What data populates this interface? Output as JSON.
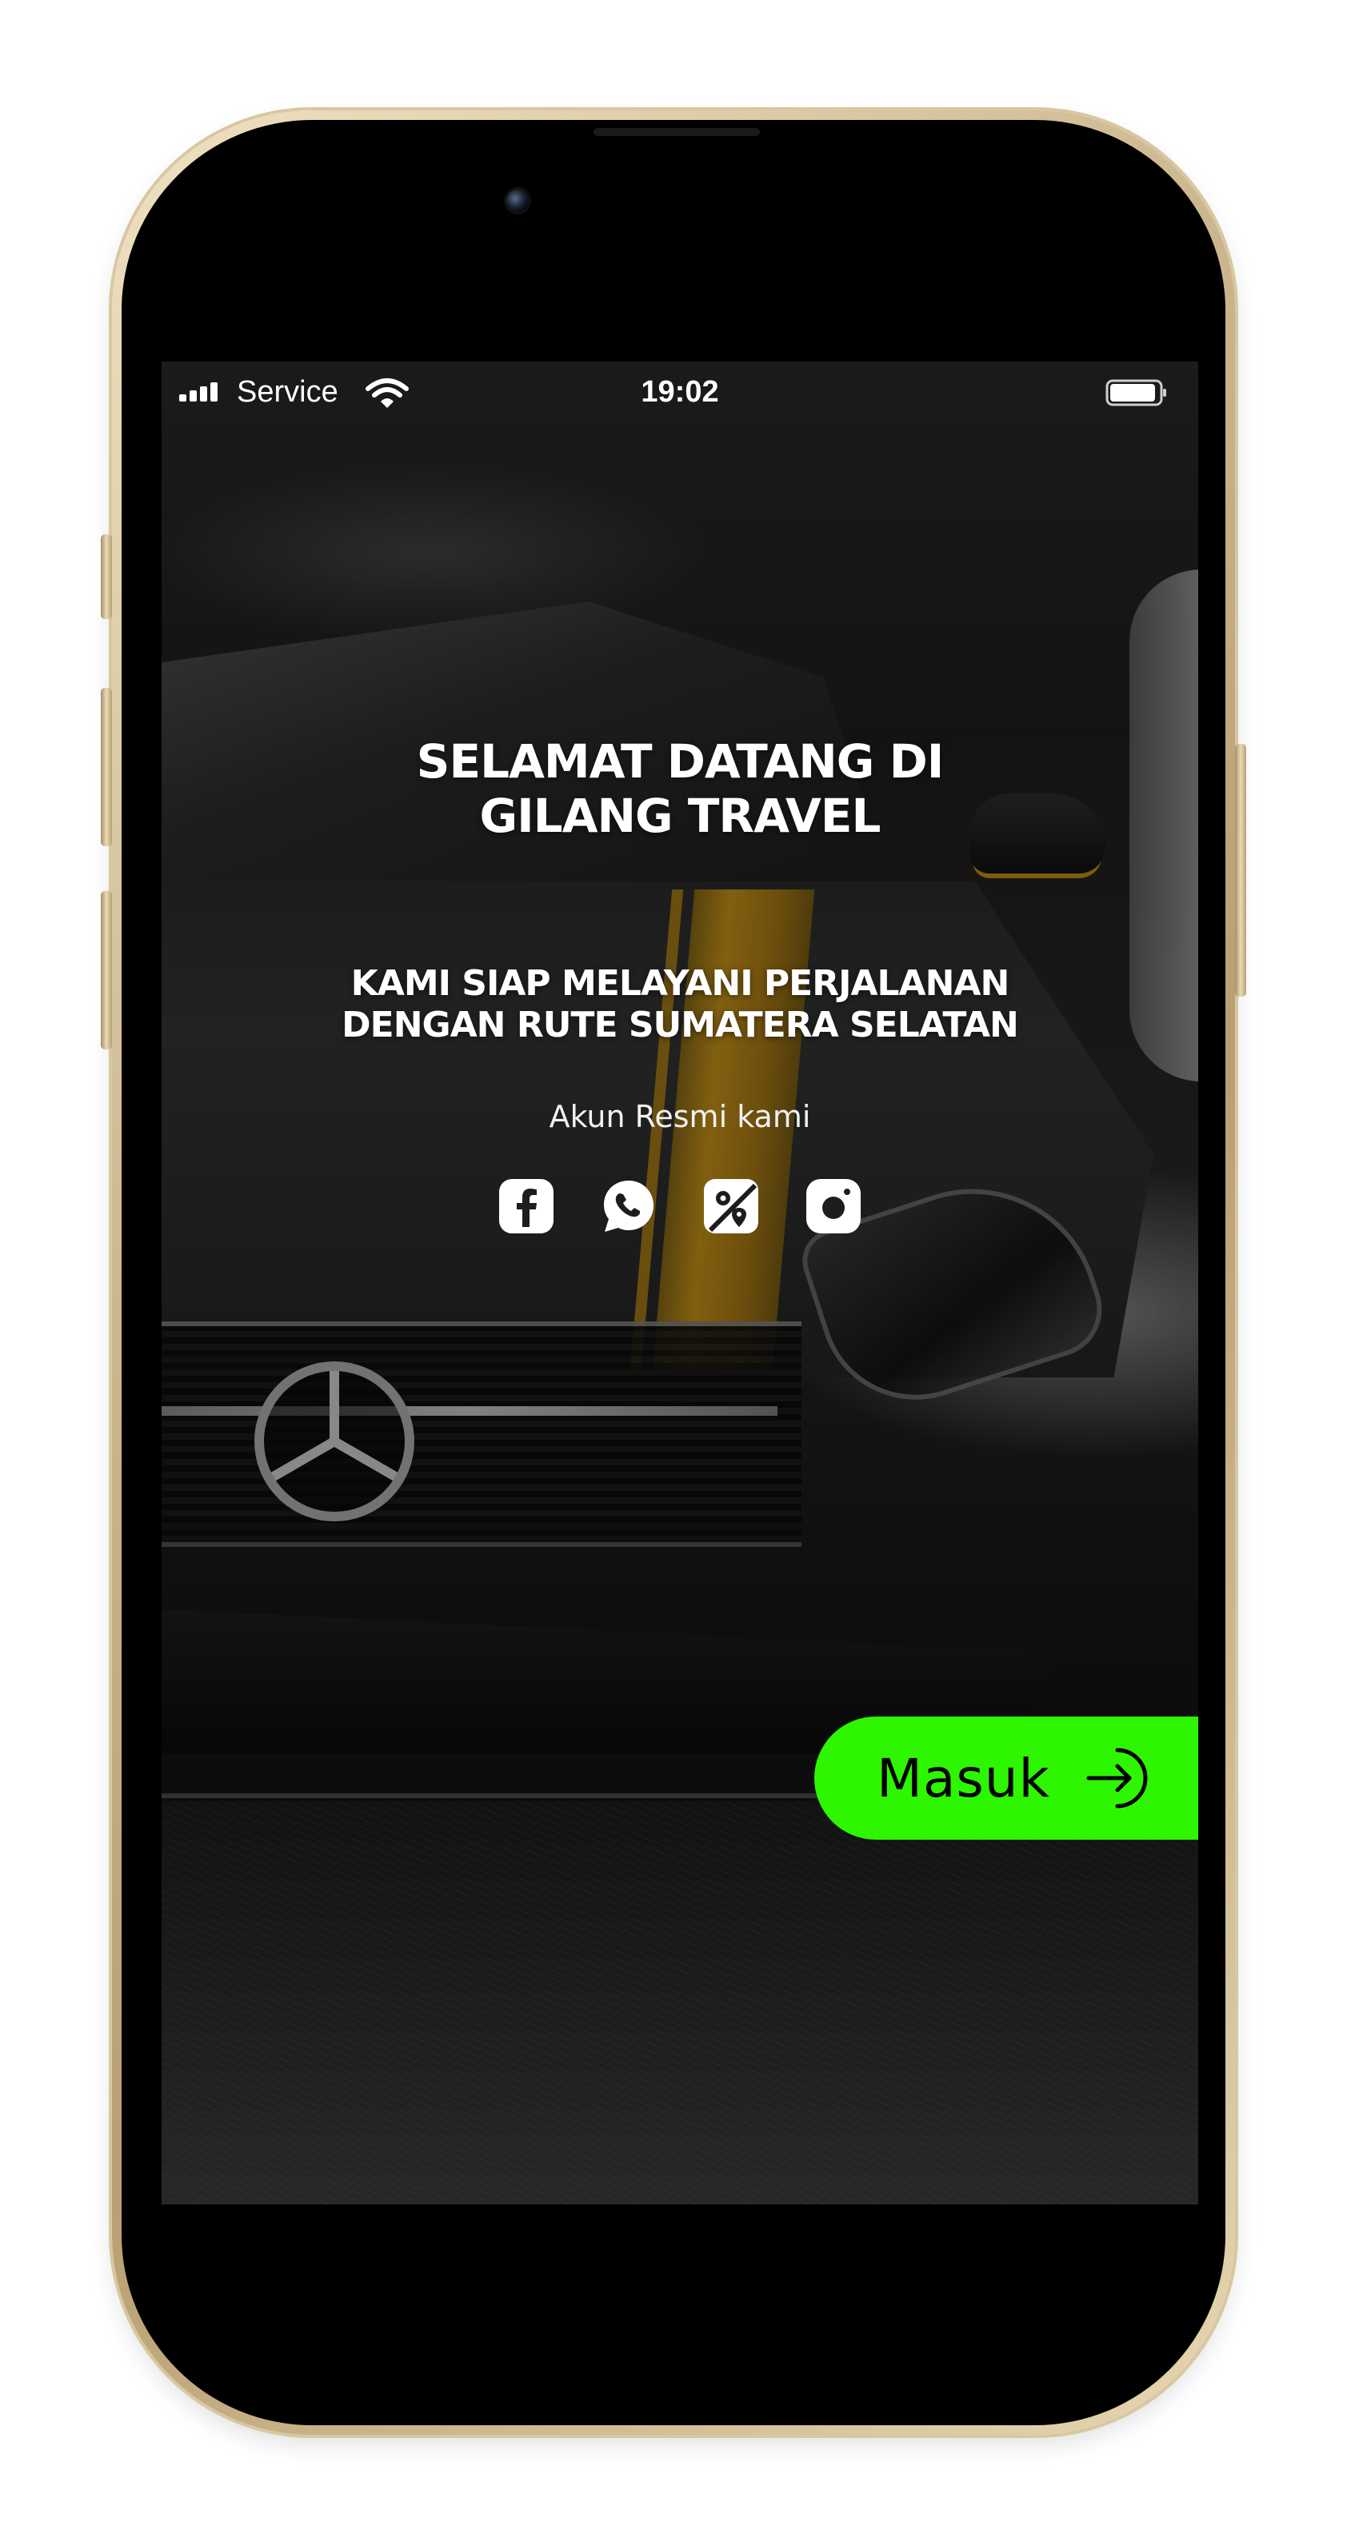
{
  "status_bar": {
    "carrier": "Service",
    "time": "19:02",
    "icons": [
      "signal-icon",
      "wifi-icon",
      "battery-icon"
    ]
  },
  "welcome": {
    "title_line1": "SELAMAT DATANG DI",
    "title_line2": "GILANG TRAVEL",
    "tagline_line1": "KAMI SIAP MELAYANI PERJALANAN",
    "tagline_line2": "DENGAN RUTE SUMATERA SELATAN"
  },
  "social": {
    "caption": "Akun Resmi kami",
    "icons": [
      "facebook-icon",
      "whatsapp-icon",
      "maps-icon",
      "instagram-icon"
    ]
  },
  "login_button": {
    "label": "Masuk",
    "icon": "arrow-right-circle-icon"
  },
  "colors": {
    "button_accent": "#2DF600",
    "stripe_accent": "#D49A15",
    "text": "#FFFFFF"
  }
}
